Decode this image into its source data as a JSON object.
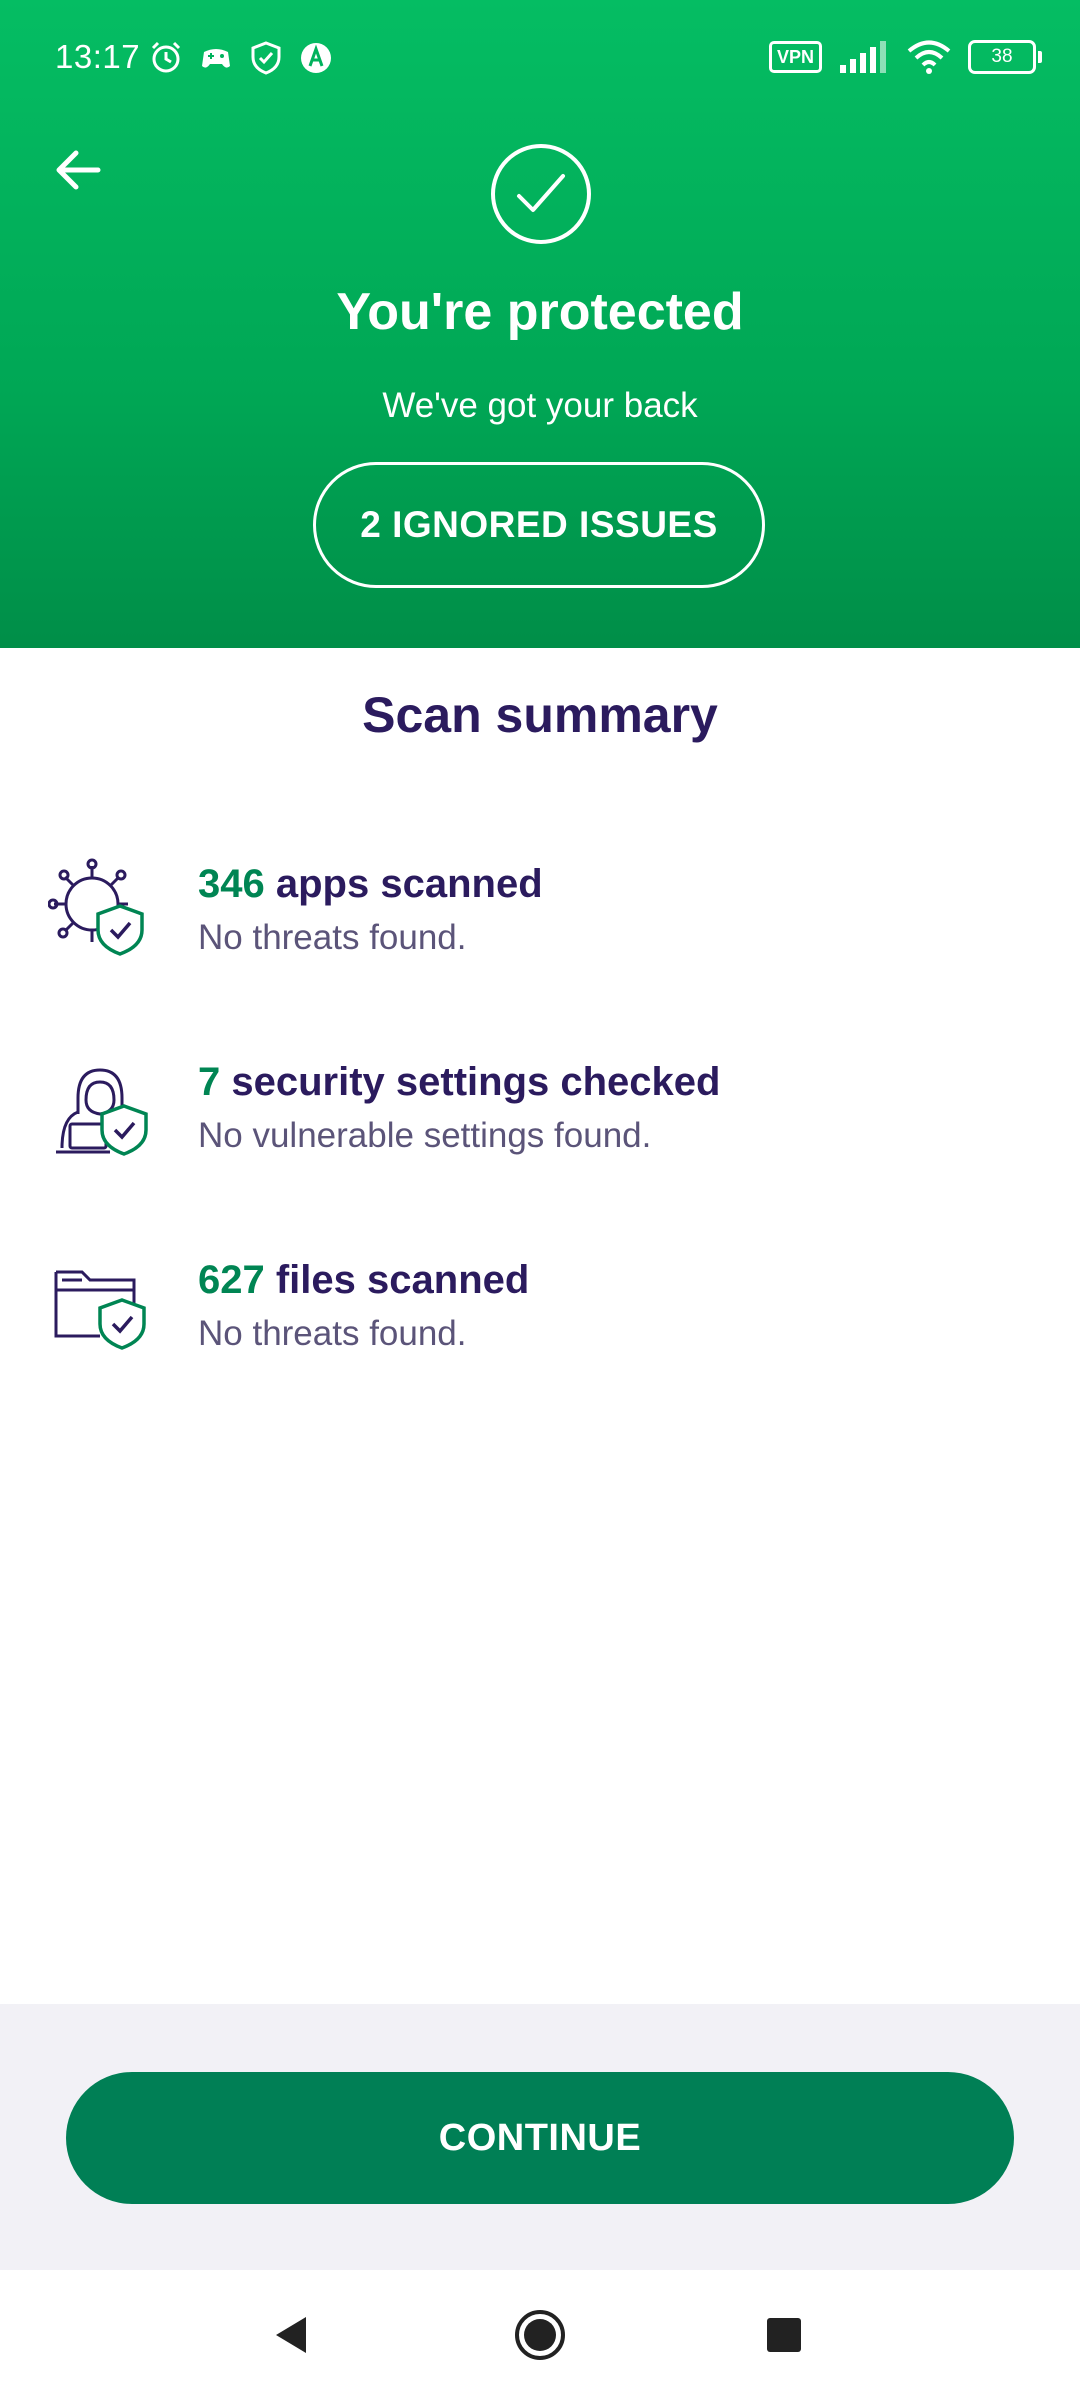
{
  "status_bar": {
    "time": "13:17",
    "vpn_label": "VPN",
    "battery_level": "38",
    "icons_left": [
      "alarm-icon",
      "game-controller-icon",
      "shield-check-icon",
      "avast-icon"
    ],
    "icons_right": [
      "vpn-icon",
      "signal-icon",
      "wifi-icon",
      "battery-icon"
    ]
  },
  "hero": {
    "title": "You're protected",
    "subtitle": "We've got your back",
    "ignored_issues_button": "2 IGNORED ISSUES",
    "background_color": "#00b25c"
  },
  "summary": {
    "title": "Scan summary",
    "items": [
      {
        "icon": "virus-shield-icon",
        "count": "346",
        "label": " apps scanned",
        "detail": "No threats found."
      },
      {
        "icon": "hacker-shield-icon",
        "count": "7",
        "label": " security settings checked",
        "detail": "No vulnerable settings found."
      },
      {
        "icon": "folder-shield-icon",
        "count": "627",
        "label": " files scanned",
        "detail": "No threats found."
      }
    ]
  },
  "footer": {
    "continue_label": "CONTINUE",
    "button_color": "#007f55"
  },
  "nav": {
    "icons": [
      "back-triangle-icon",
      "home-circle-icon",
      "recents-square-icon"
    ]
  }
}
